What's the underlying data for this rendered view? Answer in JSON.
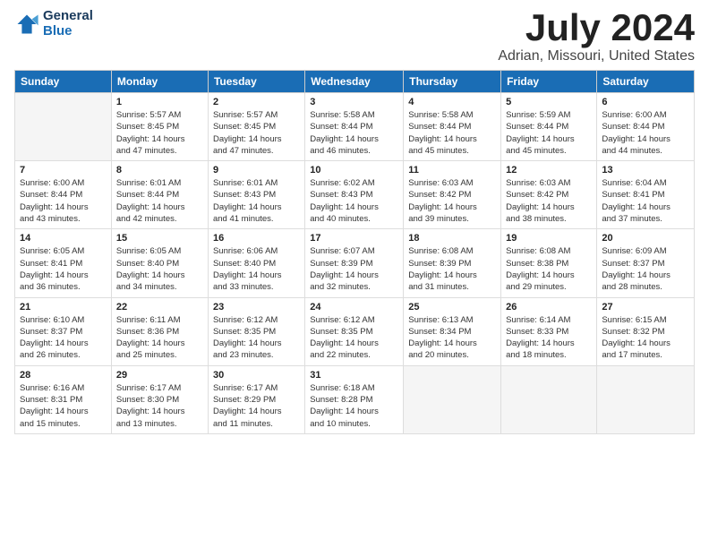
{
  "logo": {
    "text1": "General",
    "text2": "Blue"
  },
  "title": "July 2024",
  "location": "Adrian, Missouri, United States",
  "headers": [
    "Sunday",
    "Monday",
    "Tuesday",
    "Wednesday",
    "Thursday",
    "Friday",
    "Saturday"
  ],
  "weeks": [
    [
      {
        "day": "",
        "content": ""
      },
      {
        "day": "1",
        "content": "Sunrise: 5:57 AM\nSunset: 8:45 PM\nDaylight: 14 hours\nand 47 minutes."
      },
      {
        "day": "2",
        "content": "Sunrise: 5:57 AM\nSunset: 8:45 PM\nDaylight: 14 hours\nand 47 minutes."
      },
      {
        "day": "3",
        "content": "Sunrise: 5:58 AM\nSunset: 8:44 PM\nDaylight: 14 hours\nand 46 minutes."
      },
      {
        "day": "4",
        "content": "Sunrise: 5:58 AM\nSunset: 8:44 PM\nDaylight: 14 hours\nand 45 minutes."
      },
      {
        "day": "5",
        "content": "Sunrise: 5:59 AM\nSunset: 8:44 PM\nDaylight: 14 hours\nand 45 minutes."
      },
      {
        "day": "6",
        "content": "Sunrise: 6:00 AM\nSunset: 8:44 PM\nDaylight: 14 hours\nand 44 minutes."
      }
    ],
    [
      {
        "day": "7",
        "content": ""
      },
      {
        "day": "8",
        "content": "Sunrise: 6:01 AM\nSunset: 8:44 PM\nDaylight: 14 hours\nand 42 minutes."
      },
      {
        "day": "9",
        "content": "Sunrise: 6:01 AM\nSunset: 8:43 PM\nDaylight: 14 hours\nand 41 minutes."
      },
      {
        "day": "10",
        "content": "Sunrise: 6:02 AM\nSunset: 8:43 PM\nDaylight: 14 hours\nand 40 minutes."
      },
      {
        "day": "11",
        "content": "Sunrise: 6:03 AM\nSunset: 8:42 PM\nDaylight: 14 hours\nand 39 minutes."
      },
      {
        "day": "12",
        "content": "Sunrise: 6:03 AM\nSunset: 8:42 PM\nDaylight: 14 hours\nand 38 minutes."
      },
      {
        "day": "13",
        "content": "Sunrise: 6:04 AM\nSunset: 8:41 PM\nDaylight: 14 hours\nand 37 minutes."
      }
    ],
    [
      {
        "day": "14",
        "content": ""
      },
      {
        "day": "15",
        "content": "Sunrise: 6:05 AM\nSunset: 8:40 PM\nDaylight: 14 hours\nand 34 minutes."
      },
      {
        "day": "16",
        "content": "Sunrise: 6:06 AM\nSunset: 8:40 PM\nDaylight: 14 hours\nand 33 minutes."
      },
      {
        "day": "17",
        "content": "Sunrise: 6:07 AM\nSunset: 8:39 PM\nDaylight: 14 hours\nand 32 minutes."
      },
      {
        "day": "18",
        "content": "Sunrise: 6:08 AM\nSunset: 8:39 PM\nDaylight: 14 hours\nand 31 minutes."
      },
      {
        "day": "19",
        "content": "Sunrise: 6:08 AM\nSunset: 8:38 PM\nDaylight: 14 hours\nand 29 minutes."
      },
      {
        "day": "20",
        "content": "Sunrise: 6:09 AM\nSunset: 8:37 PM\nDaylight: 14 hours\nand 28 minutes."
      }
    ],
    [
      {
        "day": "21",
        "content": ""
      },
      {
        "day": "22",
        "content": "Sunrise: 6:11 AM\nSunset: 8:36 PM\nDaylight: 14 hours\nand 25 minutes."
      },
      {
        "day": "23",
        "content": "Sunrise: 6:12 AM\nSunset: 8:35 PM\nDaylight: 14 hours\nand 23 minutes."
      },
      {
        "day": "24",
        "content": "Sunrise: 6:12 AM\nSunset: 8:35 PM\nDaylight: 14 hours\nand 22 minutes."
      },
      {
        "day": "25",
        "content": "Sunrise: 6:13 AM\nSunset: 8:34 PM\nDaylight: 14 hours\nand 20 minutes."
      },
      {
        "day": "26",
        "content": "Sunrise: 6:14 AM\nSunset: 8:33 PM\nDaylight: 14 hours\nand 18 minutes."
      },
      {
        "day": "27",
        "content": "Sunrise: 6:15 AM\nSunset: 8:32 PM\nDaylight: 14 hours\nand 17 minutes."
      }
    ],
    [
      {
        "day": "28",
        "content": "Sunrise: 6:16 AM\nSunset: 8:31 PM\nDaylight: 14 hours\nand 15 minutes."
      },
      {
        "day": "29",
        "content": "Sunrise: 6:17 AM\nSunset: 8:30 PM\nDaylight: 14 hours\nand 13 minutes."
      },
      {
        "day": "30",
        "content": "Sunrise: 6:17 AM\nSunset: 8:29 PM\nDaylight: 14 hours\nand 11 minutes."
      },
      {
        "day": "31",
        "content": "Sunrise: 6:18 AM\nSunset: 8:28 PM\nDaylight: 14 hours\nand 10 minutes."
      },
      {
        "day": "",
        "content": ""
      },
      {
        "day": "",
        "content": ""
      },
      {
        "day": "",
        "content": ""
      }
    ]
  ],
  "week1_sun": "Sunrise: 6:00 AM\nSunset: 8:44 PM\nDaylight: 14 hours\nand 44 minutes.",
  "week2_sun": "Sunrise: 6:00 AM\nSunset: 8:44 PM\nDaylight: 14 hours\nand 43 minutes.",
  "week3_sun": "Sunrise: 6:05 AM\nSunset: 8:41 PM\nDaylight: 14 hours\nand 36 minutes.",
  "week4_sun": "Sunrise: 6:10 AM\nSunset: 8:37 PM\nDaylight: 14 hours\nand 26 minutes."
}
